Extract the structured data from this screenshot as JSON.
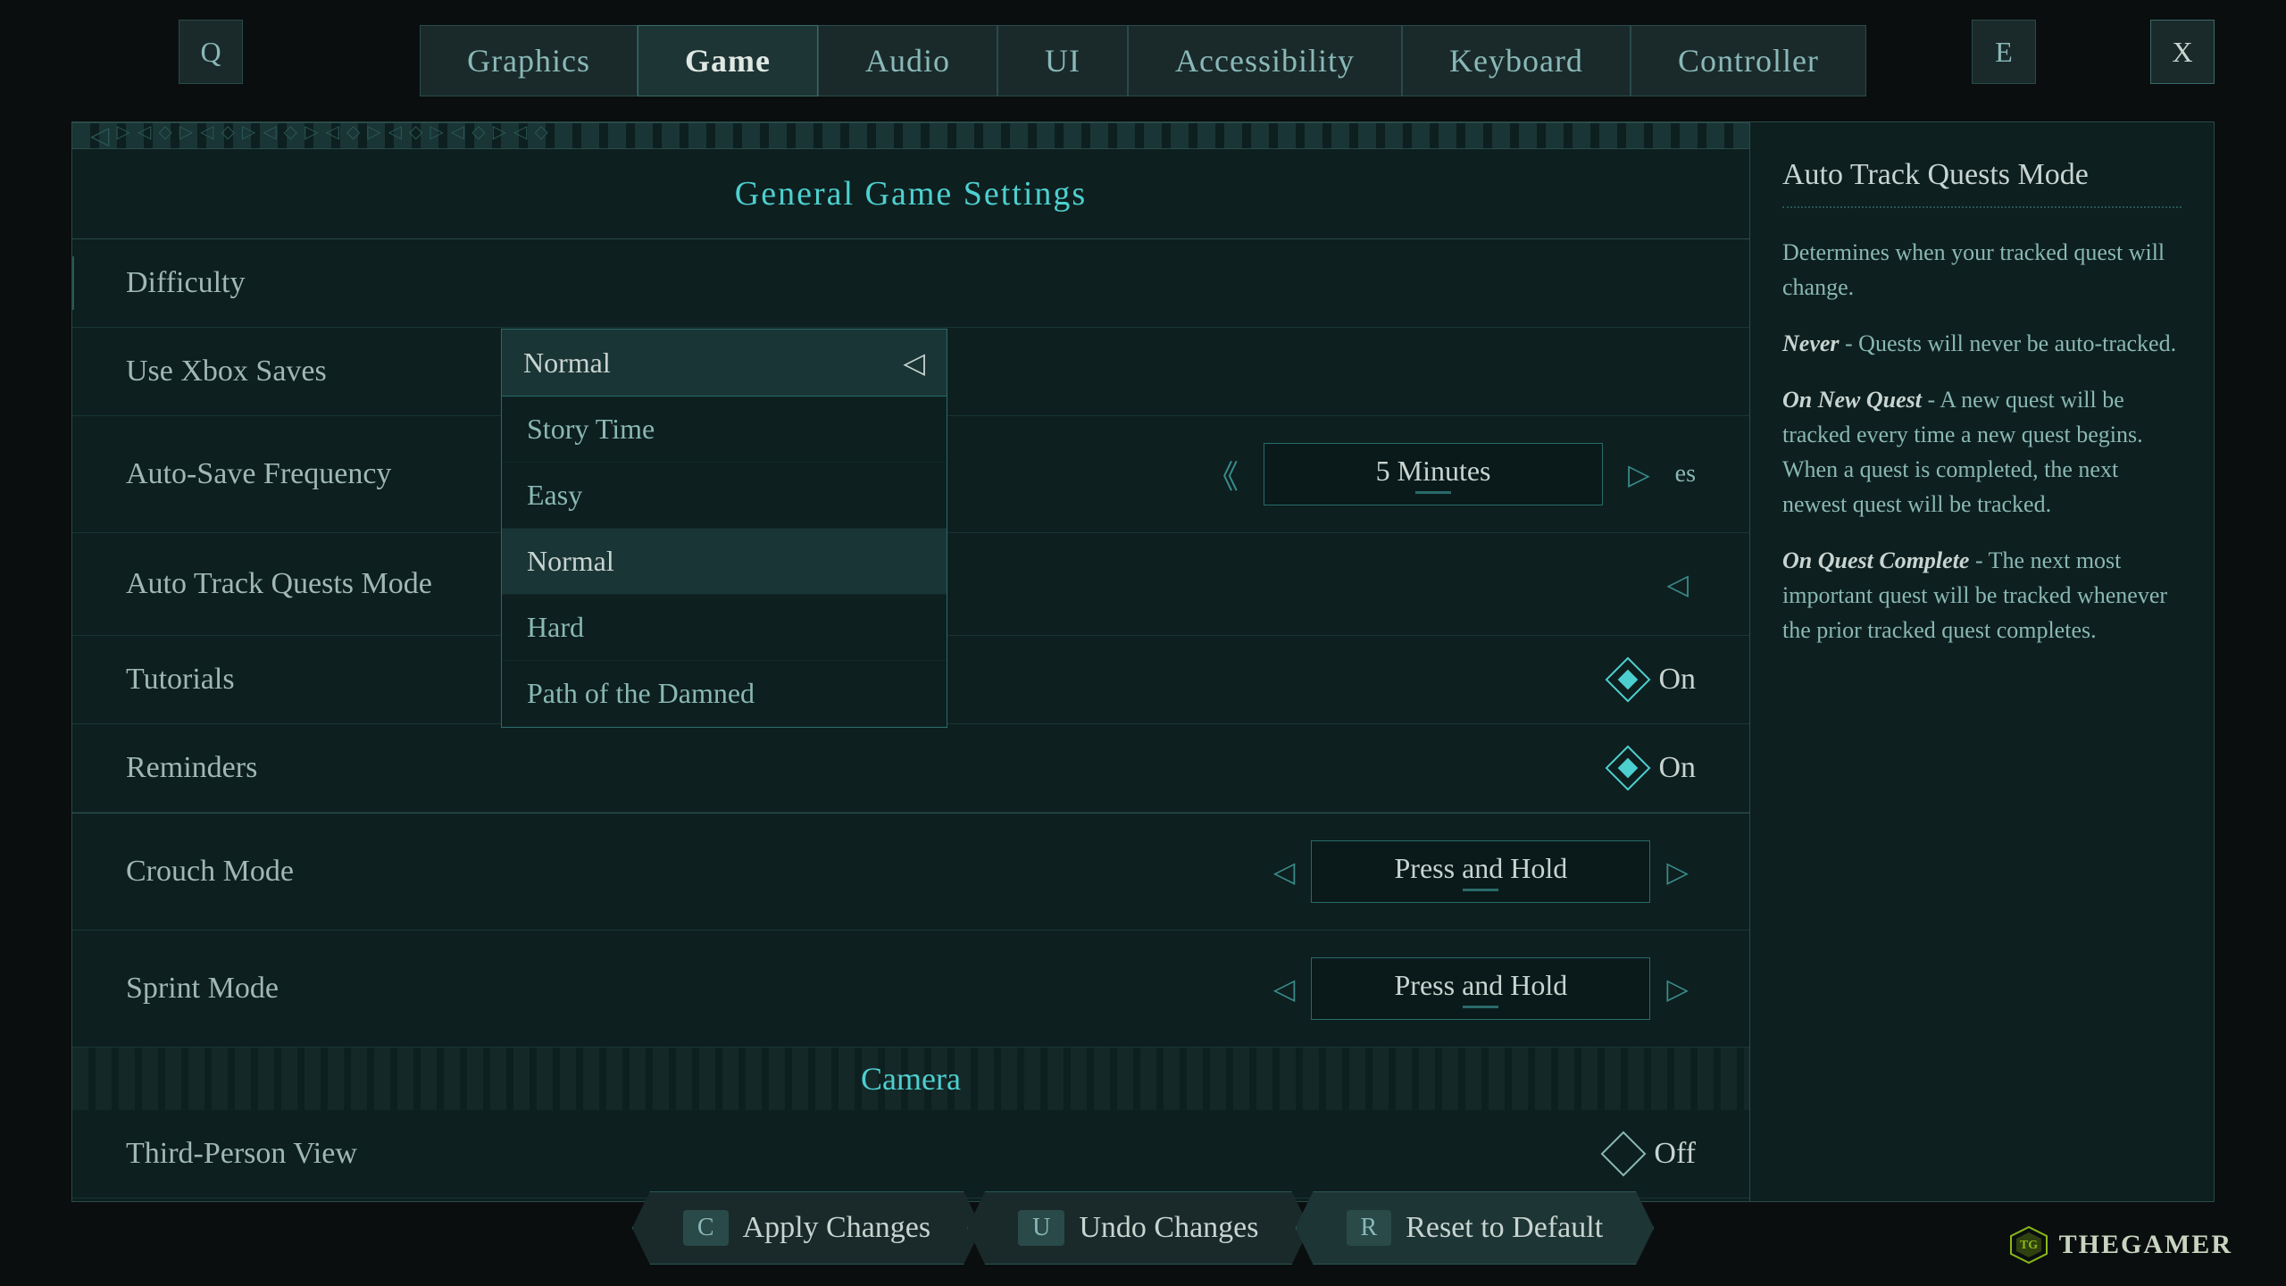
{
  "nav": {
    "tabs": [
      {
        "label": "Graphics",
        "active": false
      },
      {
        "label": "Game",
        "active": true
      },
      {
        "label": "Audio",
        "active": false
      },
      {
        "label": "UI",
        "active": false
      },
      {
        "label": "Accessibility",
        "active": false
      },
      {
        "label": "Keyboard",
        "active": false
      },
      {
        "label": "Controller",
        "active": false
      }
    ],
    "left_key": "Q",
    "right_key": "E",
    "close_key": "X"
  },
  "settings_panel": {
    "title": "General Game Settings",
    "items": [
      {
        "label": "Difficulty",
        "type": "dropdown",
        "value": "Normal"
      },
      {
        "label": "Use Xbox Saves",
        "type": "text",
        "value": ""
      },
      {
        "label": "Auto-Save Frequency",
        "type": "slider-double",
        "value": "5 Minutes"
      },
      {
        "label": "Auto Track Quests Mode",
        "type": "arrow-select",
        "value": ""
      },
      {
        "label": "Tutorials",
        "type": "toggle",
        "value": "On"
      },
      {
        "label": "Reminders",
        "type": "toggle",
        "value": "On"
      },
      {
        "label": "Crouch Mode",
        "type": "slider-select",
        "value": "Press and Hold"
      },
      {
        "label": "Sprint Mode",
        "type": "slider-select",
        "value": "Press and Hold"
      }
    ],
    "camera_section": "Camera",
    "camera_items": [
      {
        "label": "Third-Person View",
        "type": "toggle",
        "value": "Off"
      }
    ]
  },
  "dropdown": {
    "options": [
      {
        "label": "Story Time",
        "selected": false
      },
      {
        "label": "Easy",
        "selected": false
      },
      {
        "label": "Normal",
        "selected": true
      },
      {
        "label": "Hard",
        "selected": false
      },
      {
        "label": "Path of the Damned",
        "selected": false
      }
    ],
    "selected": "Normal"
  },
  "info_panel": {
    "title": "Auto Track Quests Mode",
    "description": "Determines when your tracked quest will change.",
    "entries": [
      {
        "key": "Never",
        "text": "- Quests will never be auto-tracked."
      },
      {
        "key": "On New Quest",
        "text": "- A new quest will be tracked every time a new quest begins. When a quest is completed, the next newest quest will be tracked."
      },
      {
        "key": "On Quest Complete",
        "text": "- The next most important quest will be tracked whenever the prior tracked quest completes."
      }
    ]
  },
  "bottom_bar": {
    "apply_key": "C",
    "apply_label": "Apply Changes",
    "undo_key": "U",
    "undo_label": "Undo Changes",
    "reset_key": "R",
    "reset_label": "Reset to Default"
  },
  "watermark": {
    "text": "THEGAMER"
  }
}
